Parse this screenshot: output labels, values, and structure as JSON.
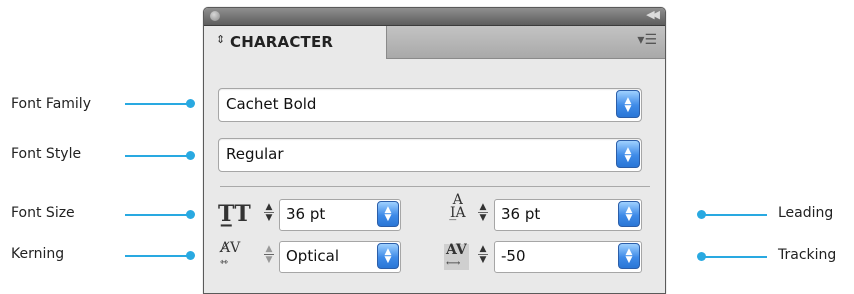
{
  "callouts": {
    "font_family": "Font Family",
    "font_style": "Font Style",
    "font_size": "Font Size",
    "kerning": "Kerning",
    "leading": "Leading",
    "tracking": "Tracking"
  },
  "panel": {
    "tab_label": "CHARACTER",
    "font_family_value": "Cachet Bold",
    "font_style_value": "Regular",
    "font_size_value": "36 pt",
    "leading_value": "36 pt",
    "kerning_value": "Optical",
    "tracking_value": "-50"
  },
  "icons": {
    "tab_arrows": "up-down-arrows-icon",
    "menu": "panel-menu-icon",
    "collapse": "collapse-icon"
  },
  "colors": {
    "callout_line": "#29a9e1",
    "button_blue": "#3f8be8"
  }
}
